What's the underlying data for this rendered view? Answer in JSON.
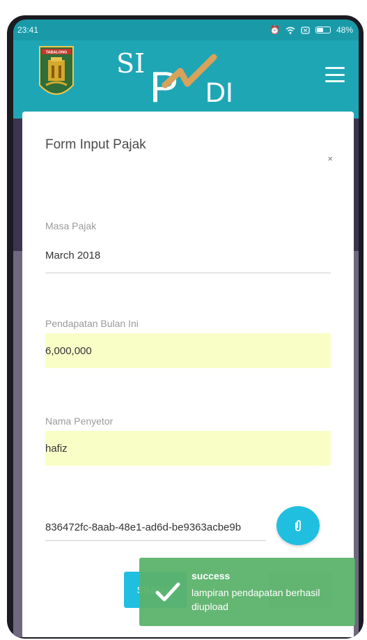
{
  "status_bar": {
    "time": "23:41",
    "battery_level": "48%",
    "icons": [
      "alarm-icon",
      "wifi-icon",
      "sim-icon",
      "battery-icon"
    ]
  },
  "app": {
    "name": "SIPADI",
    "crest_text": "TABALONG",
    "colors": {
      "primary": "#1fa6b5",
      "accent": "#20bfe0",
      "autofill": "#f9fec7",
      "toast": "#5cb26c"
    }
  },
  "modal": {
    "title": "Form Input Pajak",
    "close_label": "×",
    "fields": {
      "masa_pajak": {
        "label": "Masa Pajak",
        "value": "March 2018"
      },
      "pendapatan": {
        "label": "Pendapatan Bulan Ini",
        "value": "6,000,000"
      },
      "penyetor": {
        "label": "Nama Penyetor",
        "value": "hafiz"
      },
      "lampiran": {
        "value": "836472fc-8aab-48e1-ad6d-be9363acbe9b"
      }
    },
    "buttons": {
      "submit_label": "SIMPAN",
      "cancel_label": ""
    }
  },
  "toast": {
    "title": "success",
    "message": "lampiran pendapatan berhasil diupload"
  }
}
